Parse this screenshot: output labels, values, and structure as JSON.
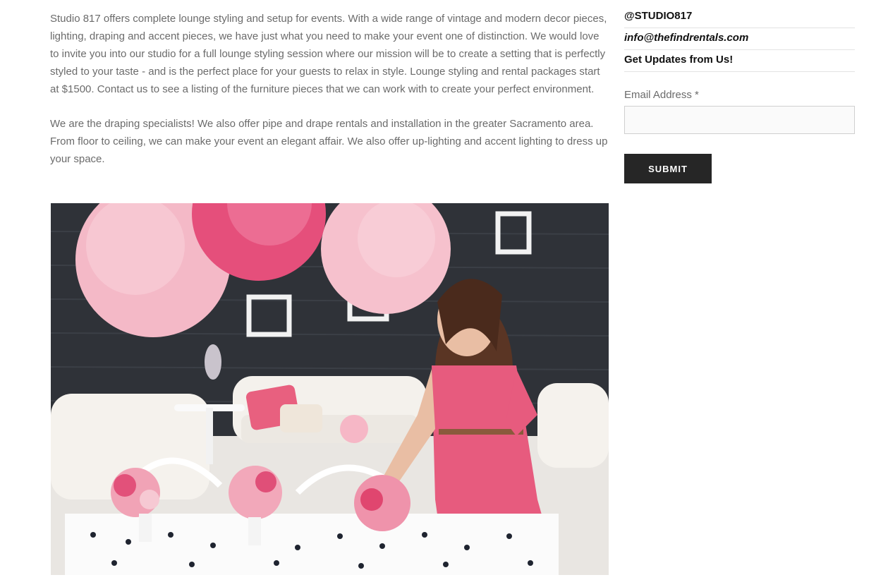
{
  "content": {
    "paragraphs": [
      "Studio 817 offers complete lounge styling and setup for events. With a wide range of vintage and modern decor pieces, lighting, draping and accent pieces, we have just what you need to make your event one of distinction. We would love to invite you into our studio for a full lounge styling session where our mission will be to create a setting that is perfectly styled to your taste - and is the perfect place for your guests to relax in style. Lounge styling and rental packages start at $1500. Contact us to see a listing of the furniture pieces that we can work with to create your perfect environment.",
      "We are the draping specialists! We also offer pipe and drape rentals and installation in the greater Sacramento area. From floor to ceiling, we can make your event an elegant affair. We also offer up-lighting and accent lighting to dress up your space."
    ]
  },
  "sidebar": {
    "handle": "@STUDIO817",
    "email_link": "info@thefindrentals.com",
    "updates_heading": "Get Updates from Us!",
    "email_label": "Email Address *",
    "email_value": "",
    "submit_label": "SUBMIT"
  },
  "colors": {
    "accent_pink": "#e8607f",
    "button_bg": "#262626"
  }
}
